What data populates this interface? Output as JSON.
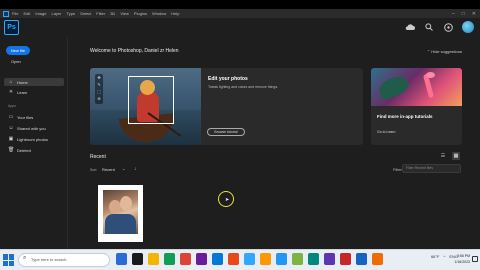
{
  "window": {
    "menu": [
      "File",
      "Edit",
      "Image",
      "Layer",
      "Type",
      "Select",
      "Filter",
      "3D",
      "View",
      "Plugins",
      "Window",
      "Help"
    ],
    "controls": {
      "minimize": "–",
      "maximize": "□",
      "close": "✕"
    }
  },
  "app": {
    "logo_text": "Ps",
    "icons": [
      "cloud-icon",
      "search-icon",
      "apps-icon",
      "avatar"
    ]
  },
  "sidebar": {
    "new_file": "New file",
    "open": "Open",
    "items": [
      {
        "label": "Home",
        "icon": "⌂",
        "active": true
      },
      {
        "label": "Learn",
        "icon": "☀",
        "active": false
      }
    ],
    "section_label": "Apps",
    "files": [
      {
        "label": "Your files",
        "icon": "▭"
      },
      {
        "label": "Shared with you",
        "icon": "☺"
      },
      {
        "label": "Lightroom photos",
        "icon": "▣"
      },
      {
        "label": "Deleted",
        "icon": "🗑"
      }
    ]
  },
  "main": {
    "welcome": "Welcome to Photoshop, Daniel zr Helen",
    "hide_suggestions": "⌃  Hide suggestions",
    "card": {
      "title": "Edit your photos",
      "description": "Tweak lighting and colors and remove things.",
      "button": "Browse tutorial"
    },
    "side_card": {
      "title": "Find more in-app tutorials",
      "link": "Go to Learn"
    },
    "recent": {
      "label": "Recent",
      "sort_label": "Sort",
      "sort_value": "Recent",
      "sort_chevron": "⌄",
      "sort_arrow": "↓",
      "filter_label": "Filter",
      "filter_placeholder": "Filter Recent files"
    }
  },
  "taskbar": {
    "search_placeholder": "Type here to search",
    "tray": [
      "66°F",
      "^",
      "ENG"
    ],
    "clock_time": "3:56 PM",
    "clock_date": "1/16/2023",
    "app_colors": [
      "#2b6bd6",
      "#1a1a1a",
      "#f4b400",
      "#0f9d58",
      "#db4437",
      "#6a1b9a",
      "#0078d4",
      "#e64a19",
      "#31a8ff",
      "#ff9800",
      "#2196f3",
      "#7cb342",
      "#00897b",
      "#5e35b1",
      "#c62828",
      "#1565c0",
      "#ef6c00"
    ]
  }
}
